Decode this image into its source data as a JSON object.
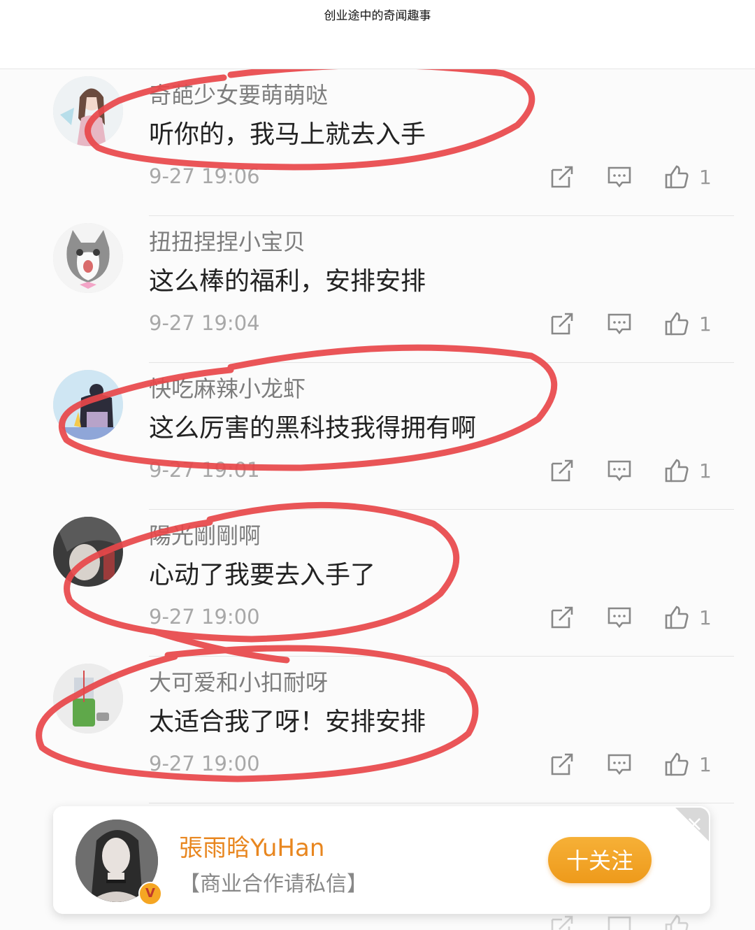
{
  "header": {
    "title": "创业途中的奇闻趣事"
  },
  "comments": [
    {
      "username": "奇葩少女要萌萌哒",
      "content": "听你的，我马上就去入手",
      "time": "9-27 19:06",
      "likes": "1",
      "avatar_icon": "girl-avatar-icon"
    },
    {
      "username": "扭扭捏捏小宝贝",
      "content": "这么棒的福利，安排安排",
      "time": "9-27 19:04",
      "likes": "1",
      "avatar_icon": "cat-avatar-icon"
    },
    {
      "username": "快吃麻辣小龙虾",
      "content": "这么厉害的黑科技我得拥有啊",
      "time": "9-27 19:01",
      "likes": "1",
      "avatar_icon": "cartoon-avatar-icon"
    },
    {
      "username": "陽光剛剛啊",
      "content": "心动了我要去入手了",
      "time": "9-27 19:00",
      "likes": "1",
      "avatar_icon": "portrait-avatar-icon"
    },
    {
      "username": "大可爱和小扣耐呀",
      "content": "太适合我了呀！安排安排",
      "time": "9-27 19:00",
      "likes": "1",
      "avatar_icon": "bottle-avatar-icon"
    }
  ],
  "follow_card": {
    "name": "張雨晗YuHan",
    "description": "【商业合作请私信】",
    "follow_label": "十关注",
    "close_label": "×",
    "verified_icon": "verified-v-icon",
    "accent_color": "#f0a02a"
  },
  "annotation_color": "#e8474a"
}
